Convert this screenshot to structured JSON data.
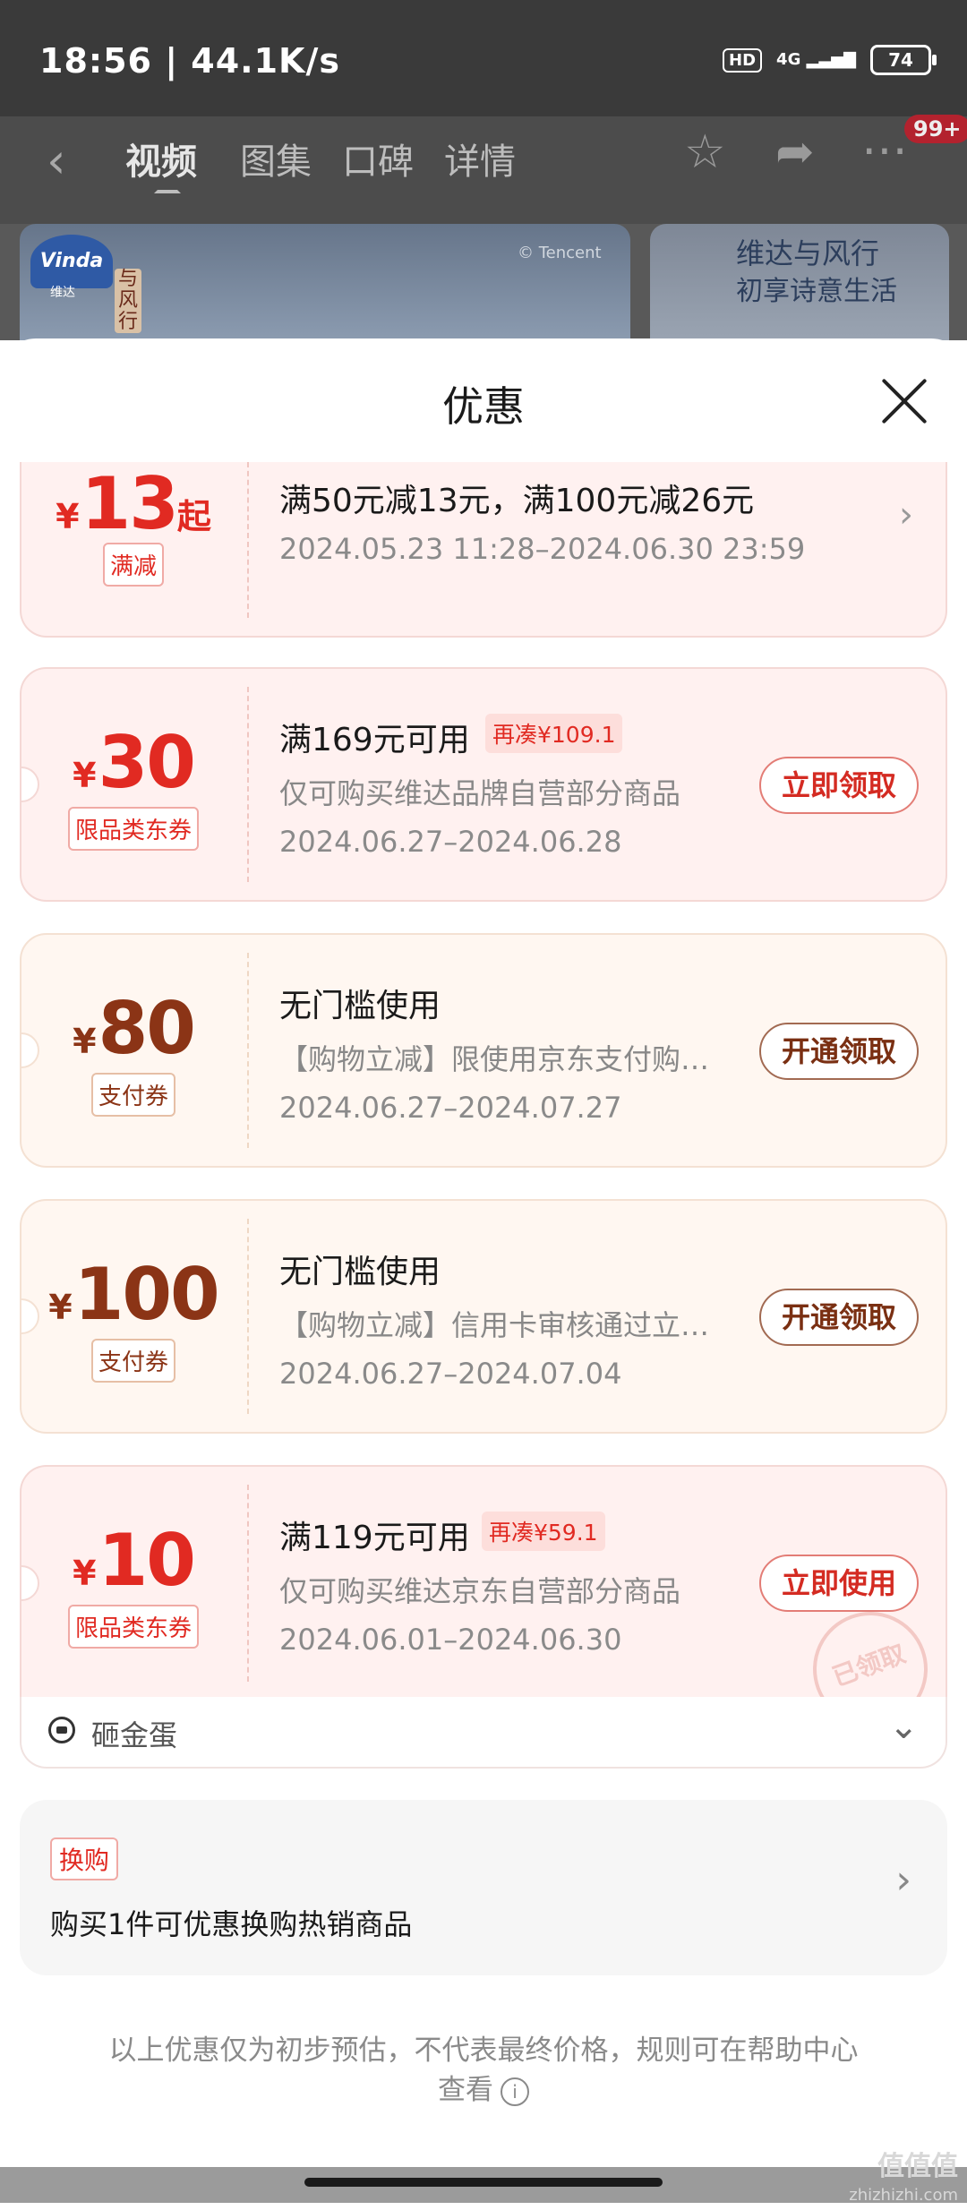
{
  "status_bar": {
    "time": "18:56 | 44.1K/s",
    "hd": "HD",
    "network": "4G",
    "battery": "74"
  },
  "header": {
    "tabs": [
      {
        "label": "视频",
        "active": true
      },
      {
        "label": "图集",
        "active": false
      },
      {
        "label": "口碑",
        "active": false
      },
      {
        "label": "详情",
        "active": false
      }
    ],
    "badge": "99+"
  },
  "banners": {
    "brand_logo": "Vinda",
    "brand_logo_sub": "维达",
    "left_vertical": "与风行",
    "copyright": "© Tencent",
    "right_title": "维达与风行",
    "right_subtitle": "初享诗意生活"
  },
  "sheet": {
    "title": "优惠"
  },
  "coupons": [
    {
      "yen": "¥",
      "amount": "13",
      "suffix": "起",
      "tag": "满减",
      "condition": "满50元减13元，满100元减26元",
      "date": "2024.05.23 11:28–2024.06.30 23:59",
      "style": "red"
    },
    {
      "yen": "¥",
      "amount": "30",
      "tag": "限品类东券",
      "condition": "满169元可用",
      "extra": "再凑¥109.1",
      "desc": "仅可购买维达品牌自营部分商品",
      "date": "2024.06.27–2024.06.28",
      "action": "立即领取",
      "style": "red"
    },
    {
      "yen": "¥",
      "amount": "80",
      "tag": "支付券",
      "condition": "无门槛使用",
      "desc": "【购物立减】限使用京东支付购…",
      "date": "2024.06.27–2024.07.27",
      "action": "开通领取",
      "style": "brown"
    },
    {
      "yen": "¥",
      "amount": "100",
      "tag": "支付券",
      "condition": "无门槛使用",
      "desc": "【购物立减】信用卡审核通过立…",
      "date": "2024.06.27–2024.07.04",
      "action": "开通领取",
      "style": "brown"
    },
    {
      "yen": "¥",
      "amount": "10",
      "tag": "限品类东券",
      "condition": "满119元可用",
      "extra": "再凑¥59.1",
      "desc": "仅可购买维达京东自营部分商品",
      "date": "2024.06.01–2024.06.30",
      "action": "立即使用",
      "stamp": "已领取",
      "style": "red"
    }
  ],
  "smash": {
    "label": "砸金蛋"
  },
  "swap": {
    "tag": "换购",
    "text": "购买1件可优惠换购热销商品"
  },
  "footnote": "以上优惠仅为初步预估，不代表最终价格，规则可在帮助中心查看",
  "watermark": {
    "main": "值值值",
    "sub": "zhizhizhi.com"
  },
  "colors": {
    "accent_red": "#e12a22",
    "accent_brown": "#8b3416"
  }
}
